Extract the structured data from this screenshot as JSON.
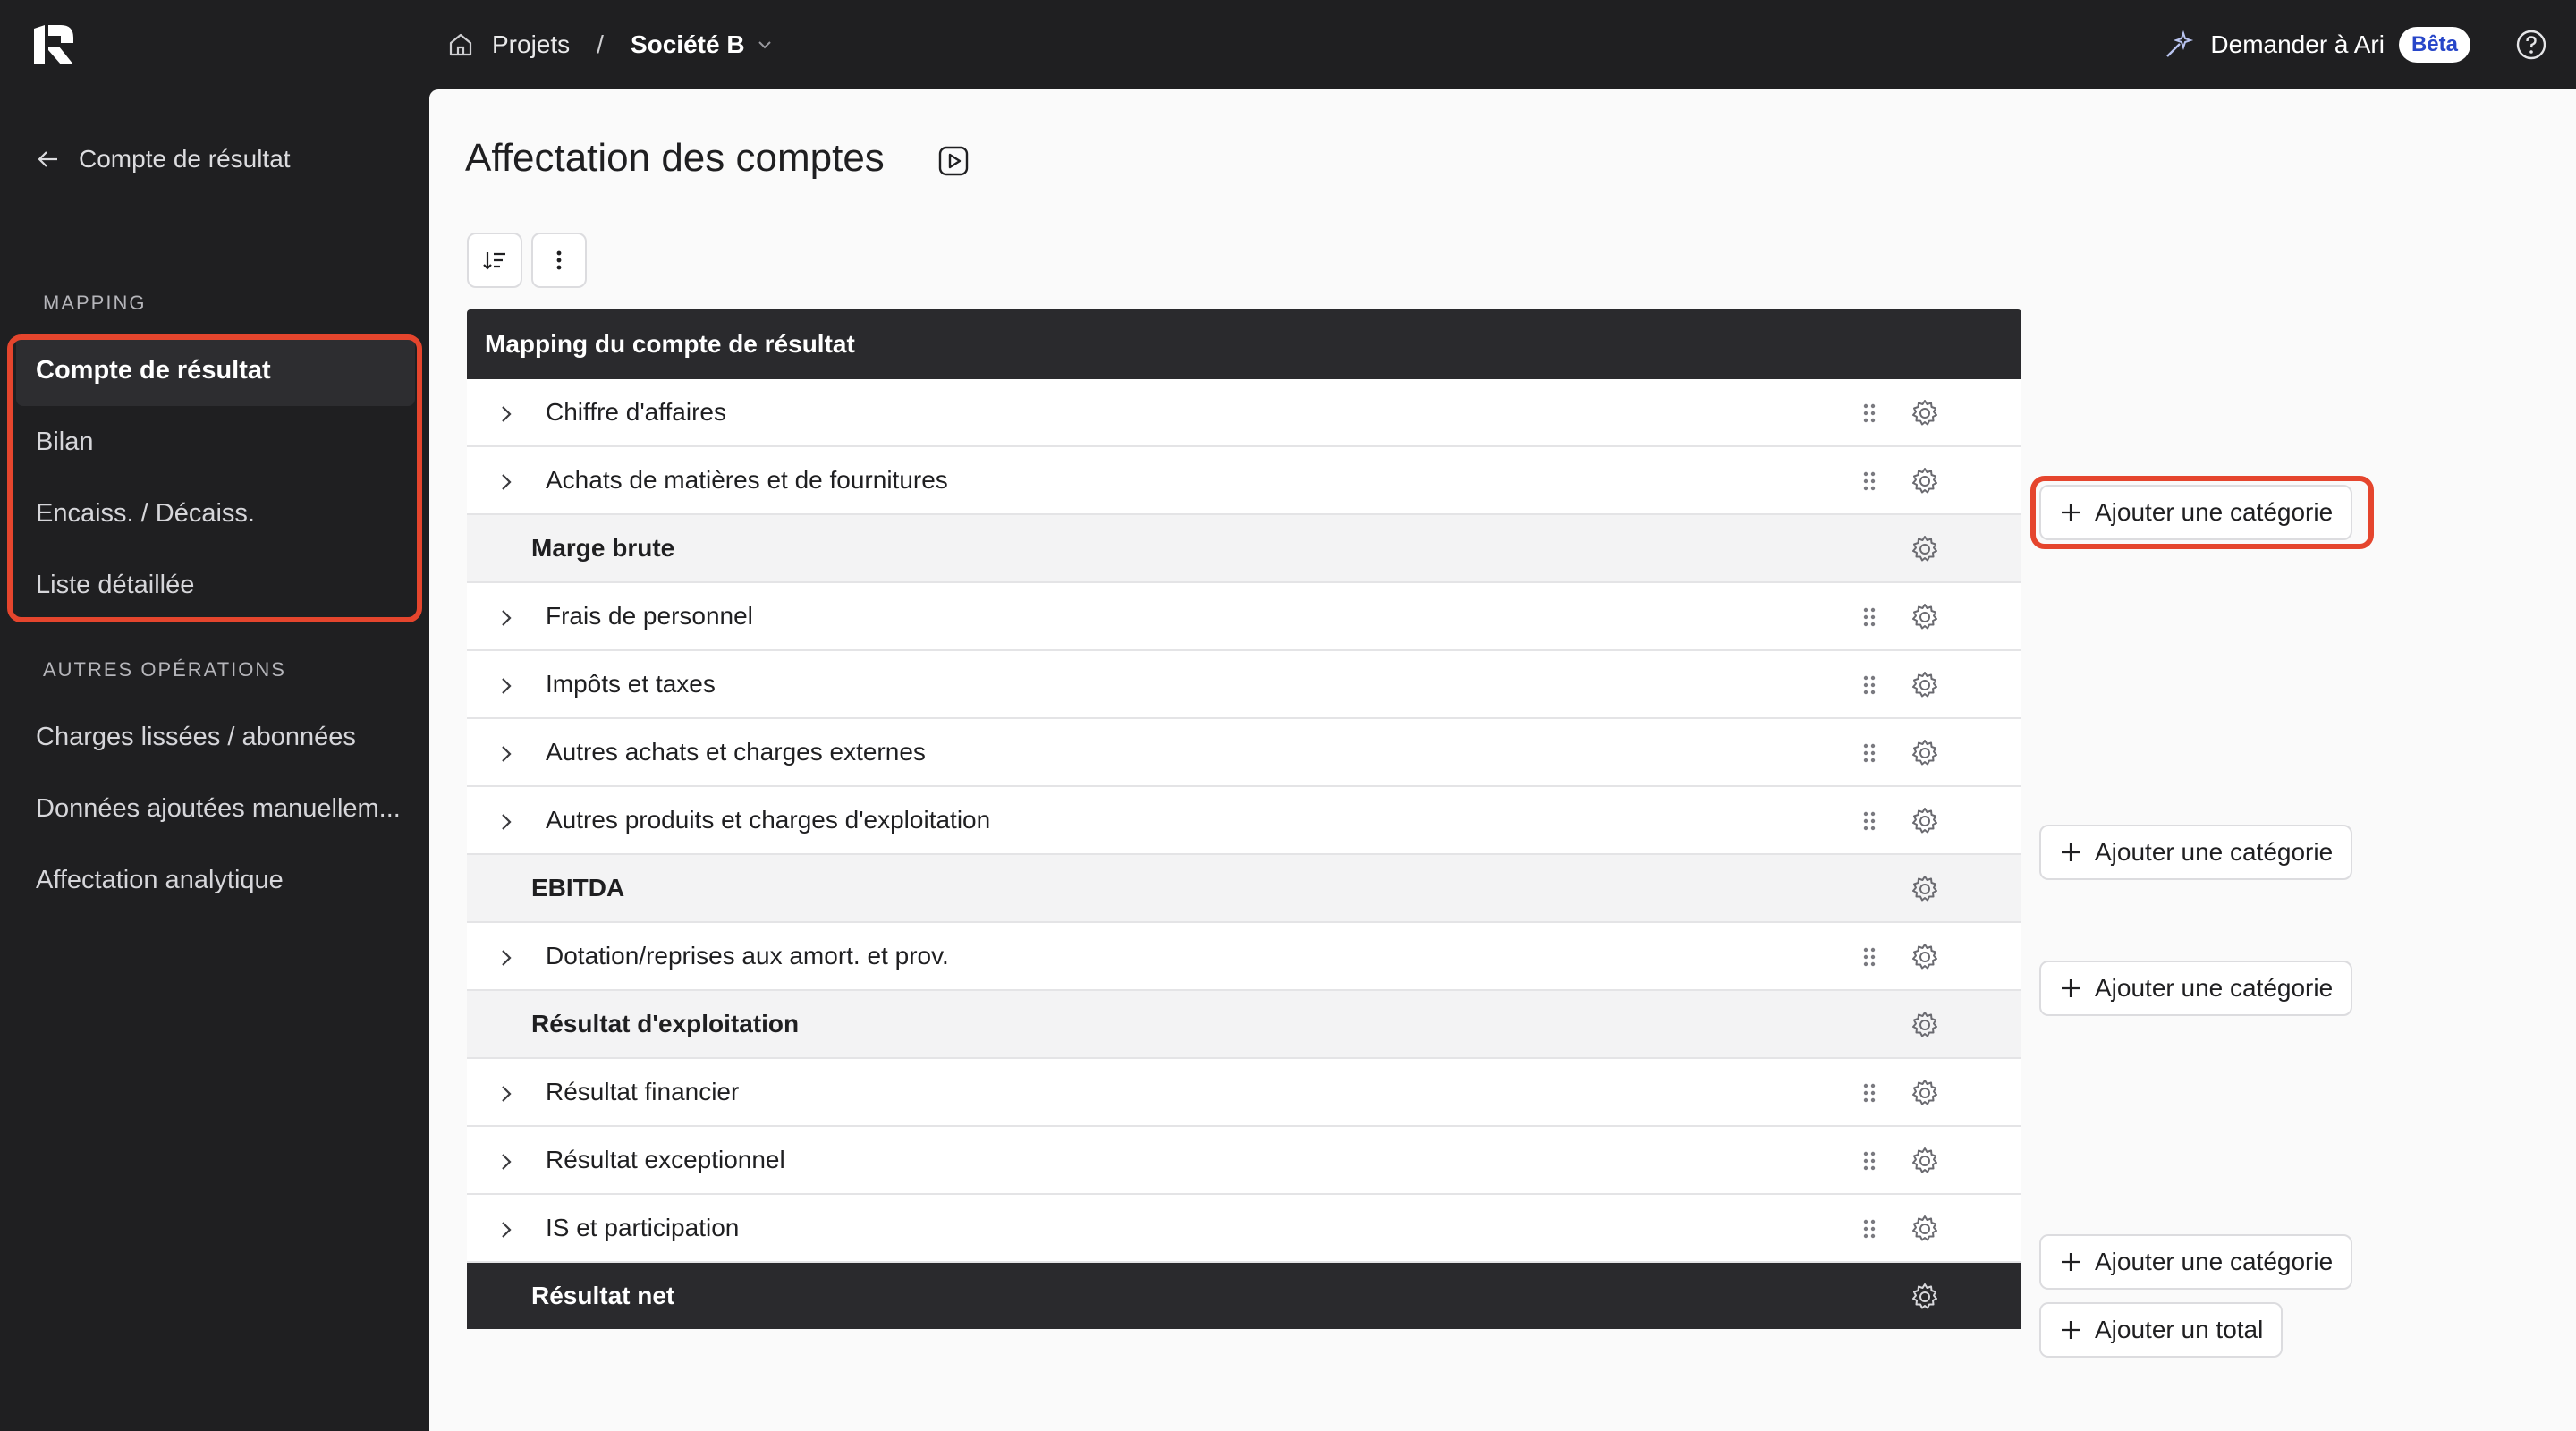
{
  "topbar": {
    "breadcrumb_projects": "Projets",
    "breadcrumb_sep": "/",
    "breadcrumb_company": "Société B",
    "ask_label": "Demander à Ari",
    "beta_badge": "Bêta"
  },
  "sidebar": {
    "back_label": "Compte de résultat",
    "section_mapping": "MAPPING",
    "mapping_items": [
      {
        "label": "Compte de résultat",
        "active": true
      },
      {
        "label": "Bilan"
      },
      {
        "label": "Encaiss. / Décaiss."
      },
      {
        "label": "Liste détaillée"
      }
    ],
    "section_other": "AUTRES OPÉRATIONS",
    "other_items": [
      {
        "label": "Charges lissées / abonnées"
      },
      {
        "label": "Données ajoutées manuellem..."
      },
      {
        "label": "Affectation analytique"
      }
    ]
  },
  "main": {
    "title": "Affectation des comptes",
    "table_header": "Mapping du compte de résultat",
    "rows": [
      {
        "label": "Chiffre d'affaires",
        "type": "category"
      },
      {
        "label": "Achats de matières et de fournitures",
        "type": "category"
      },
      {
        "label": "Marge brute",
        "type": "total"
      },
      {
        "label": "Frais de personnel",
        "type": "category"
      },
      {
        "label": "Impôts et taxes",
        "type": "category"
      },
      {
        "label": "Autres achats et charges externes",
        "type": "category"
      },
      {
        "label": "Autres produits et charges d'exploitation",
        "type": "category"
      },
      {
        "label": "EBITDA",
        "type": "total"
      },
      {
        "label": "Dotation/reprises aux amort. et prov.",
        "type": "category"
      },
      {
        "label": "Résultat d'exploitation",
        "type": "total"
      },
      {
        "label": "Résultat financier",
        "type": "category"
      },
      {
        "label": "Résultat exceptionnel",
        "type": "category"
      },
      {
        "label": "IS et participation",
        "type": "category"
      },
      {
        "label": "Résultat net",
        "type": "net"
      }
    ],
    "add_category_label": "Ajouter une catégorie",
    "add_total_label": "Ajouter un total"
  },
  "colors": {
    "highlight": "#e5452d",
    "dark_bg": "#1f1f21",
    "beta_text": "#2746c9"
  }
}
